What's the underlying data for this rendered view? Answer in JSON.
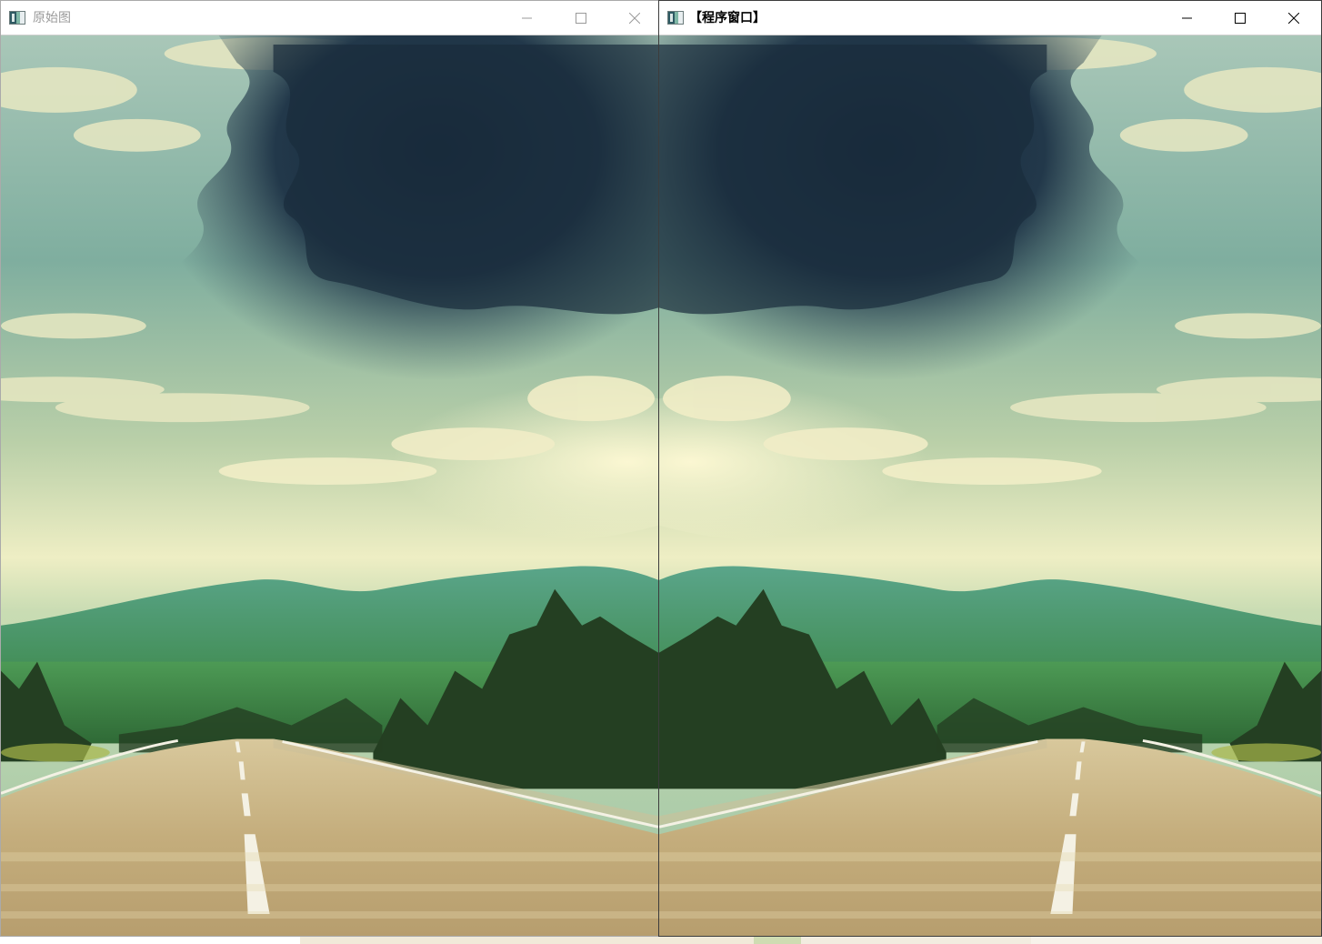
{
  "windows": [
    {
      "title": "原始图",
      "state": "inactive",
      "image": "landscape-road-clouds",
      "flipped": false,
      "controls": [
        "minimize-icon",
        "maximize-icon",
        "close-icon"
      ]
    },
    {
      "title": "【程序窗口】",
      "state": "active",
      "image": "landscape-road-clouds",
      "flipped": true,
      "controls": [
        "minimize-icon",
        "maximize-icon",
        "close-icon"
      ]
    }
  ],
  "colors": {
    "sky_top": "#9fc3b6",
    "storm_cloud": "#1e3240",
    "haze": "#f2f0c2",
    "mountains": "#4f9b80",
    "forest": "#2b4a25",
    "road": "#c9b58a",
    "lane_marking": "#f4f1e4"
  }
}
